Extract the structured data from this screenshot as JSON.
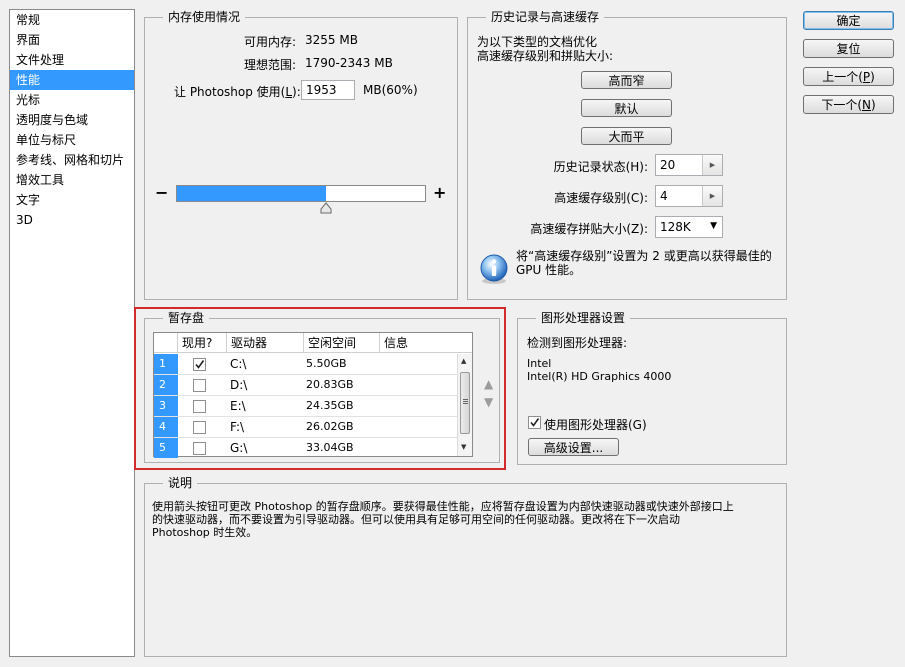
{
  "sidebar": {
    "items": [
      {
        "label": "常规"
      },
      {
        "label": "界面"
      },
      {
        "label": "文件处理"
      },
      {
        "label": "性能",
        "selected": true
      },
      {
        "label": "光标"
      },
      {
        "label": "透明度与色域"
      },
      {
        "label": "单位与标尺"
      },
      {
        "label": "参考线、网格和切片"
      },
      {
        "label": "增效工具"
      },
      {
        "label": "文字"
      },
      {
        "label": "3D"
      }
    ]
  },
  "actions": {
    "ok": "确定",
    "reset": "复位",
    "prev": "上一个(",
    "prev_key": "P",
    "next": "下一个(",
    "next_key": "N"
  },
  "memory": {
    "title": "内存使用情况",
    "available_label": "可用内存:",
    "available_value": "3255 MB",
    "ideal_label": "理想范围:",
    "ideal_value": "1790-2343 MB",
    "let_label_pre": "让 Photoshop 使用(",
    "let_label_key": "L",
    "let_label_post": "):",
    "use_value": "1953",
    "use_unit": "MB(60%)",
    "usage_fraction": 0.6,
    "minus": "−",
    "plus": "+"
  },
  "history": {
    "title": "历史记录与高速缓存",
    "desc_line1": "为以下类型的文档优化",
    "desc_line2": "高速缓存级别和拼贴大小:",
    "btn_tall_thin": "高而窄",
    "btn_default": "默认",
    "btn_wide_flat": "大而平",
    "states_label": "历史记录状态(H):",
    "states_value": "20",
    "cache_levels_label": "高速缓存级别(C):",
    "cache_levels_value": "4",
    "tile_size_label": "高速缓存拼贴大小(Z):",
    "tile_size_value": "128K",
    "info_line1": "将“高速缓存级别”设置为 2 或更高以获得最佳的",
    "info_line2": "GPU 性能。"
  },
  "scratch": {
    "title": "暂存盘",
    "headers": [
      "现用?",
      "驱动器",
      "空闲空间",
      "信息"
    ],
    "rows": [
      {
        "num": "1",
        "checked": true,
        "drive": "C:\\",
        "free": "5.50GB"
      },
      {
        "num": "2",
        "checked": false,
        "drive": "D:\\",
        "free": "20.83GB"
      },
      {
        "num": "3",
        "checked": false,
        "drive": "E:\\",
        "free": "24.35GB"
      },
      {
        "num": "4",
        "checked": false,
        "drive": "F:\\",
        "free": "26.02GB"
      },
      {
        "num": "5",
        "checked": false,
        "drive": "G:\\",
        "free": "33.04GB"
      }
    ]
  },
  "gpu": {
    "title": "图形处理器设置",
    "detected_label": "检测到图形处理器:",
    "vendor": "Intel",
    "model": "Intel(R) HD Graphics 4000",
    "use_gpu_label": "使用图形处理器(G)",
    "use_gpu_checked": true,
    "advanced_button": "高级设置..."
  },
  "description": {
    "title": "说明",
    "line1": "使用箭头按钮可更改 Photoshop 的暂存盘顺序。要获得最佳性能，应将暂存盘设置为内部快速驱动器或快速外部接口上",
    "line2": "的快速驱动器，而不要设置为引导驱动器。但可以使用具有足够可用空间的任何驱动器。更改将在下一次启动",
    "line3": "Photoshop 时生效。"
  }
}
